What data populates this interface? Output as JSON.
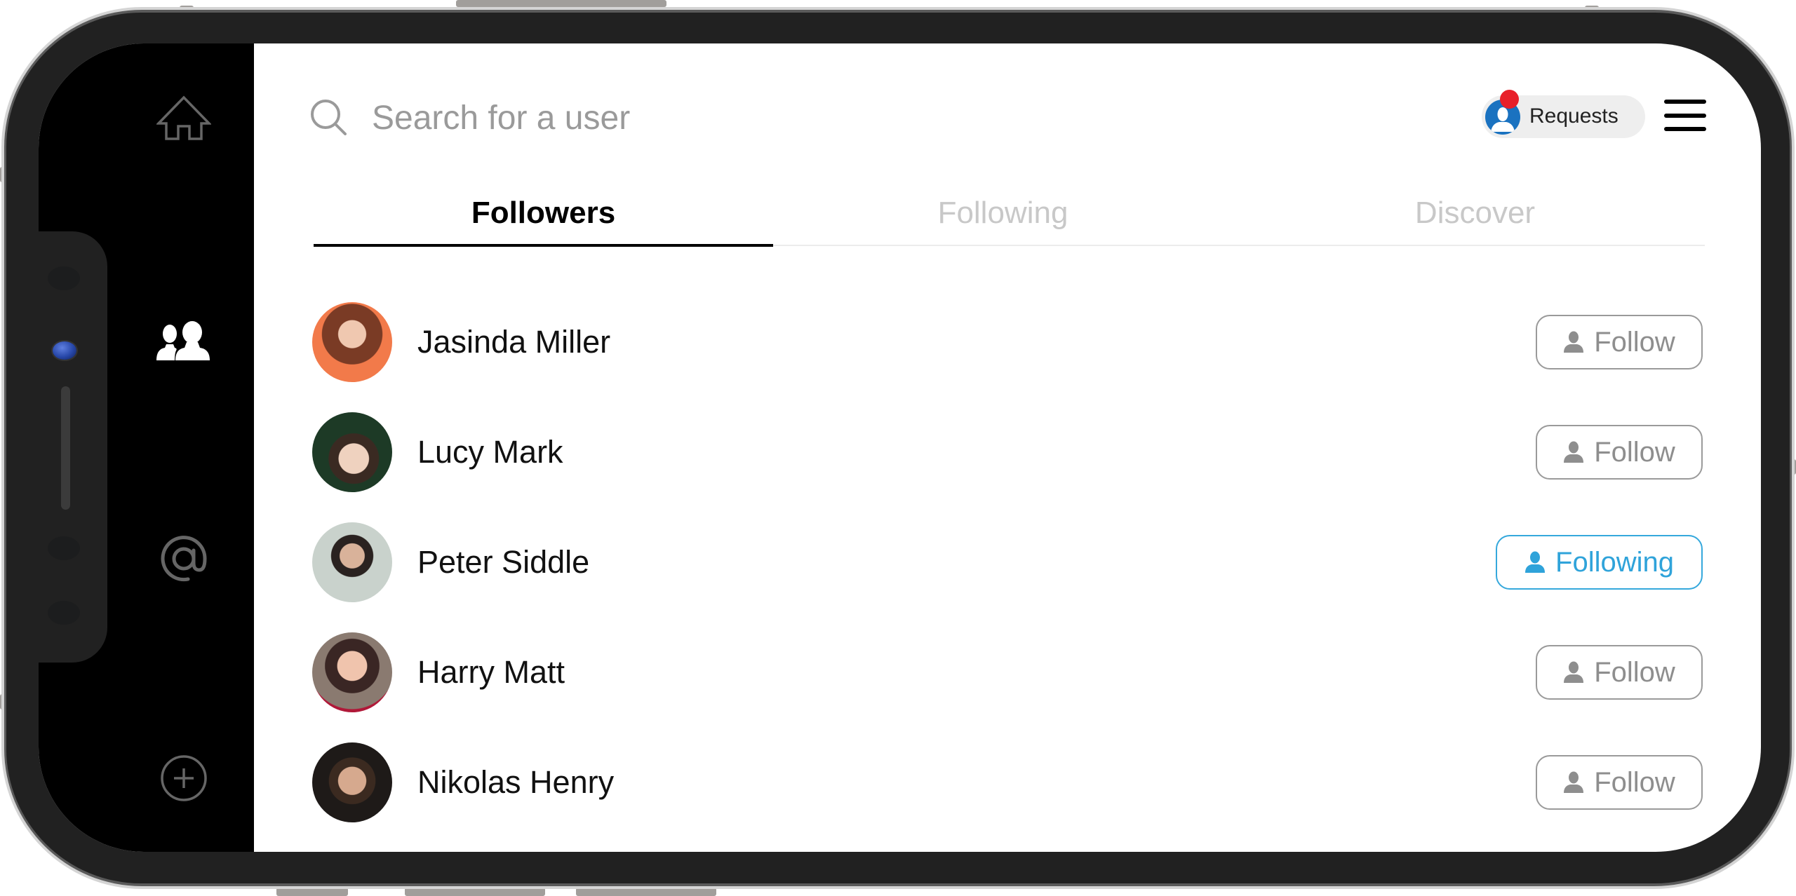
{
  "sidebar": {
    "items": [
      {
        "id": "home",
        "icon": "home-icon",
        "active": false
      },
      {
        "id": "people",
        "icon": "people-icon",
        "active": true
      },
      {
        "id": "mentions",
        "icon": "at-sign-icon",
        "active": false
      },
      {
        "id": "add",
        "icon": "plus-circle-icon",
        "active": false
      }
    ]
  },
  "search": {
    "placeholder": "Search for a user",
    "value": ""
  },
  "requests": {
    "label": "Requests",
    "has_notification": true
  },
  "tabs": [
    {
      "label": "Followers",
      "active": true
    },
    {
      "label": "Following",
      "active": false
    },
    {
      "label": "Discover",
      "active": false
    }
  ],
  "users": [
    {
      "name": "Jasinda Miller",
      "action": "Follow",
      "state": "follow"
    },
    {
      "name": "Lucy Mark",
      "action": "Follow",
      "state": "follow"
    },
    {
      "name": "Peter Siddle",
      "action": "Following",
      "state": "following"
    },
    {
      "name": "Harry Matt",
      "action": "Follow",
      "state": "follow"
    },
    {
      "name": "Nikolas Henry",
      "action": "Follow",
      "state": "follow"
    }
  ],
  "colors": {
    "accent": "#35a8dc",
    "notification": "#e8202a",
    "requests_avatar": "#1a72c0",
    "inactive_tab": "#c8c8c8"
  }
}
